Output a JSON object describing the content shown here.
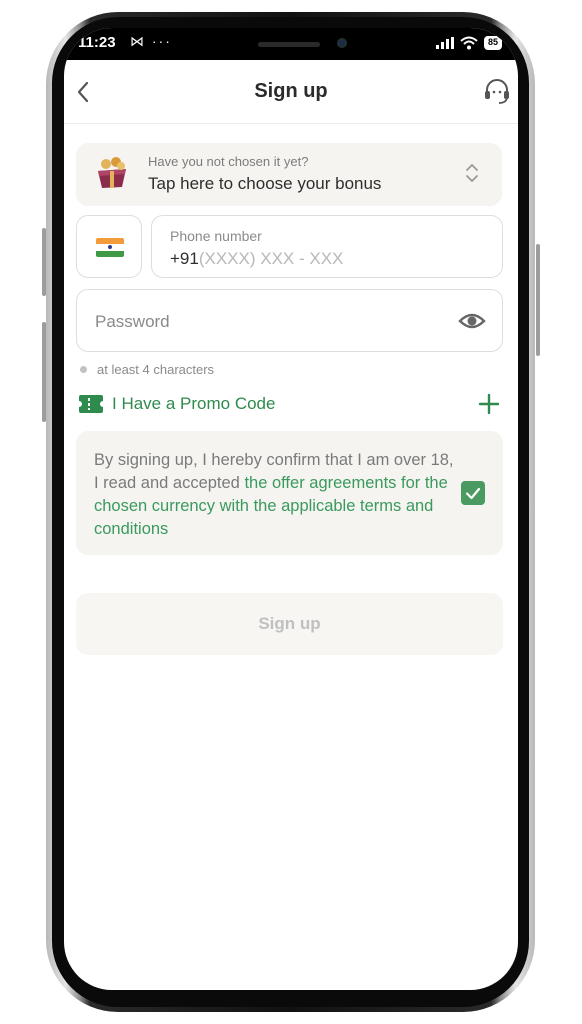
{
  "status_bar": {
    "time": "11:23",
    "left_icons": "⋈ ···",
    "battery": "85"
  },
  "header": {
    "title": "Sign up"
  },
  "bonus": {
    "hint": "Have you not chosen it yet?",
    "label": "Tap here to choose your bonus"
  },
  "phone": {
    "label": "Phone number",
    "prefix": "+91",
    "mask": "(XXXX) XXX - XXX"
  },
  "password": {
    "placeholder": "Password",
    "hint": "at least 4 characters"
  },
  "promo": {
    "label": "I Have a Promo Code"
  },
  "terms": {
    "text": "By signing up, I hereby confirm that I am over 18, I read and accepted ",
    "link": "the offer agreements for the chosen currency with the applicable terms and conditions",
    "checked": true
  },
  "submit": {
    "label": "Sign up"
  },
  "colors": {
    "accent_green": "#3a9a5e",
    "card_bg": "#f5f4f0",
    "disabled_text": "#c0c0c0"
  }
}
